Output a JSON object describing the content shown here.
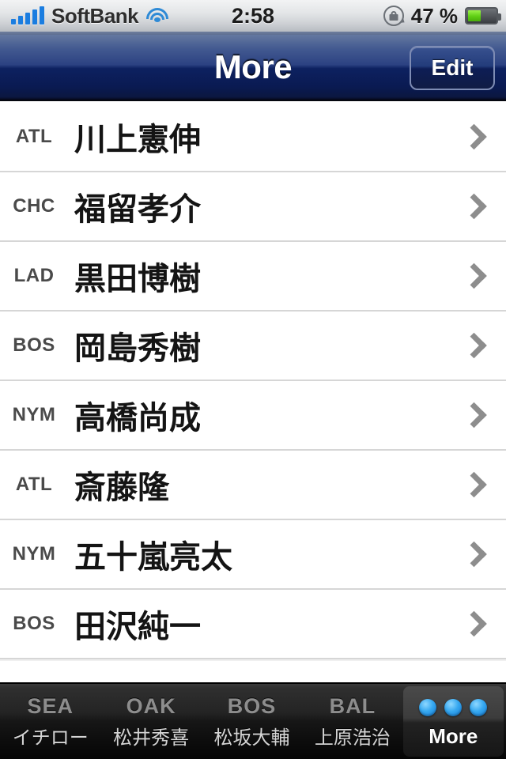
{
  "status_bar": {
    "carrier": "SoftBank",
    "signal_icon": "signal-bars-icon",
    "signal_bars_filled": 5,
    "wifi_icon": "wifi-icon",
    "time": "2:58",
    "rotation_lock_icon": "rotation-lock-icon",
    "battery_percent_label": "47 %",
    "battery_level": 47,
    "battery_icon": "battery-icon"
  },
  "nav_bar": {
    "title": "More",
    "edit_label": "Edit",
    "accent_color": "#0d2160"
  },
  "list": {
    "rows": [
      {
        "team": "ATL",
        "name": "川上憲伸",
        "chevron_icon": "chevron-right-icon"
      },
      {
        "team": "CHC",
        "name": "福留孝介",
        "chevron_icon": "chevron-right-icon"
      },
      {
        "team": "LAD",
        "name": "黒田博樹",
        "chevron_icon": "chevron-right-icon"
      },
      {
        "team": "BOS",
        "name": "岡島秀樹",
        "chevron_icon": "chevron-right-icon"
      },
      {
        "team": "NYM",
        "name": "高橋尚成",
        "chevron_icon": "chevron-right-icon"
      },
      {
        "team": "ATL",
        "name": "斎藤隆",
        "chevron_icon": "chevron-right-icon"
      },
      {
        "team": "NYM",
        "name": "五十嵐亮太",
        "chevron_icon": "chevron-right-icon"
      },
      {
        "team": "BOS",
        "name": "田沢純一",
        "chevron_icon": "chevron-right-icon"
      }
    ]
  },
  "tab_bar": {
    "tabs": [
      {
        "abbr": "SEA",
        "label": "イチロー",
        "selected": false
      },
      {
        "abbr": "OAK",
        "label": "松井秀喜",
        "selected": false
      },
      {
        "abbr": "BOS",
        "label": "松坂大輔",
        "selected": false
      },
      {
        "abbr": "BAL",
        "label": "上原浩治",
        "selected": false
      }
    ],
    "more_tab": {
      "label": "More",
      "icon": "three-dots-icon",
      "selected": true,
      "dot_color": "#36a8f0"
    }
  }
}
